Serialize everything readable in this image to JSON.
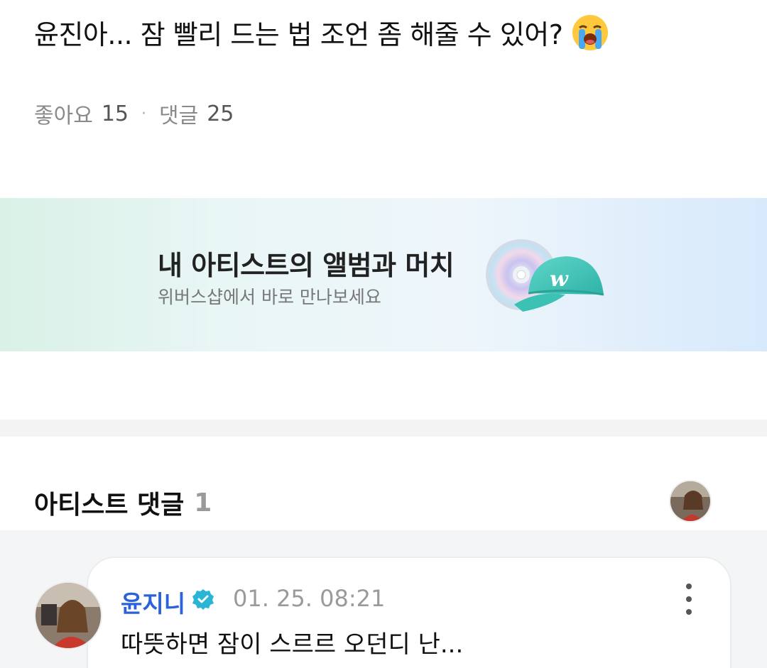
{
  "post": {
    "title": "윤진아... 잠 빨리 드는 법 조언 좀 해줄 수 있어?",
    "emoji_icon": "loudly-crying-face-emoji",
    "likes_label": "좋아요",
    "likes_count": "15",
    "separator": "·",
    "comments_label": "댓글",
    "comments_count": "25"
  },
  "banner": {
    "title": "내 아티스트의 앨범과 머치",
    "subtitle": "위버스샵에서 바로 만나보세요",
    "illustration_icons": [
      "cd-disc-icon",
      "weverse-cap-icon"
    ],
    "cap_logo_letter": "w"
  },
  "artist_comments": {
    "header_label": "아티스트 댓글",
    "count": "1",
    "comment": {
      "author": "윤지니",
      "verified_icon": "verified-badge-icon",
      "timestamp": "01. 25. 08:21",
      "text": "따뜻하면 잠이 스르르 오던디 난..."
    }
  },
  "colors": {
    "author_name": "#2b62d9",
    "badge": "#2bb5d4",
    "meta_text": "#8a8a8a",
    "section_bg": "#f4f5f7"
  }
}
